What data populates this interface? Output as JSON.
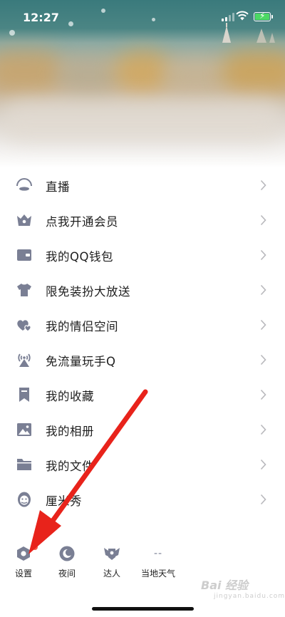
{
  "status_bar": {
    "time": "12:27"
  },
  "menu": {
    "items": [
      {
        "label": "直播",
        "icon": "live-icon"
      },
      {
        "label": "点我开通会员",
        "icon": "vip-crown-icon"
      },
      {
        "label": "我的QQ钱包",
        "icon": "wallet-icon"
      },
      {
        "label": "限免装扮大放送",
        "icon": "tshirt-icon"
      },
      {
        "label": "我的情侣空间",
        "icon": "hearts-icon"
      },
      {
        "label": "免流量玩手Q",
        "icon": "antenna-icon"
      },
      {
        "label": "我的收藏",
        "icon": "bookmark-icon"
      },
      {
        "label": "我的相册",
        "icon": "photo-icon"
      },
      {
        "label": "我的文件",
        "icon": "folder-icon"
      },
      {
        "label": "厘米秀",
        "icon": "avatar-face-icon"
      }
    ]
  },
  "bottom_bar": {
    "settings_label": "设置",
    "night_label": "夜间",
    "talent_label": "达人",
    "weather_value": "--",
    "weather_label": "当地天气"
  },
  "watermark": {
    "text": "Bai 经验",
    "sub": "jingyan.baidu.com"
  },
  "colors": {
    "icon_gray": "#7a7f94",
    "chevron_gray": "#b8b8bc",
    "badge_red": "#f55b4a",
    "arrow_red": "#e8231b"
  }
}
